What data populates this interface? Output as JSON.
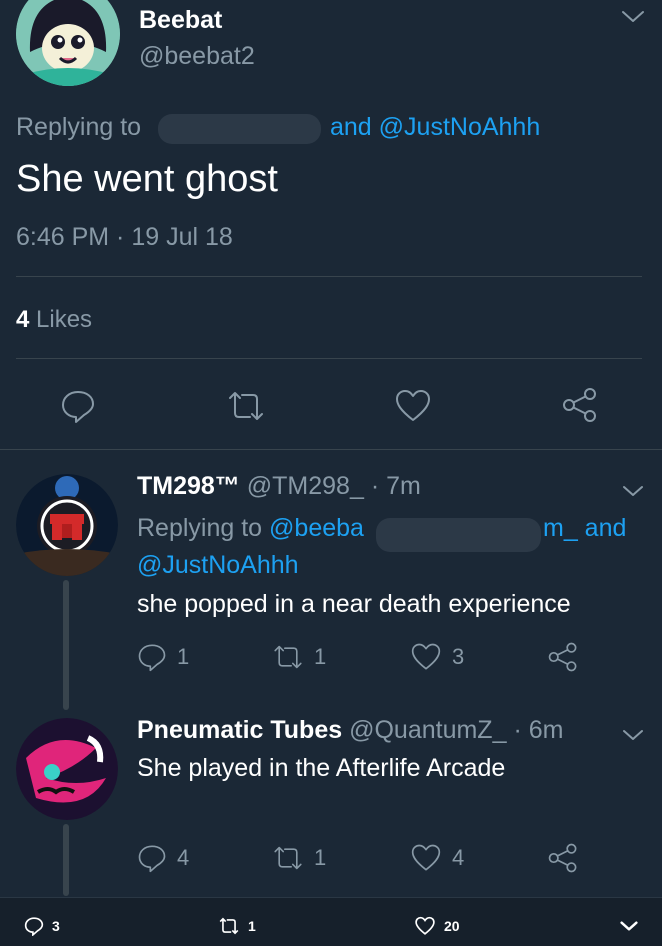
{
  "main_tweet": {
    "display_name": "Beebat",
    "handle": "@beebat2",
    "replying_prefix": "Replying to",
    "replying_suffix": "and @JustNoAhhh",
    "text": "She went ghost",
    "timestamp": "6:46 PM · 19 Jul 18",
    "likes_count": "4",
    "likes_label": "Likes"
  },
  "replies": [
    {
      "display_name": "TM298™",
      "handle": "@TM298_",
      "time": "· 7m",
      "replying_prefix": "Replying to",
      "replying_mention_start": "@beeba",
      "replying_mention_end": "m_ and",
      "replying_line2": "@JustNoAhhh",
      "text": "she popped in a near death experience",
      "reply_count": "1",
      "retweet_count": "1",
      "like_count": "3"
    },
    {
      "display_name": "Pneumatic Tubes",
      "handle": "@QuantumZ_",
      "time": "· 6m",
      "text": "She played in the Afterlife Arcade",
      "reply_count": "4",
      "retweet_count": "1",
      "like_count": "4"
    }
  ],
  "bottom_bar": {
    "reply_count": "3",
    "retweet_count": "1",
    "like_count": "20"
  },
  "icons": {
    "reply": "reply-icon",
    "retweet": "retweet-icon",
    "like": "heart-icon",
    "share": "share-icon",
    "more": "chevron-down-icon"
  },
  "colors": {
    "background": "#1b2836",
    "link": "#1da1f2",
    "muted": "#8899a6",
    "divider": "#38444d"
  }
}
